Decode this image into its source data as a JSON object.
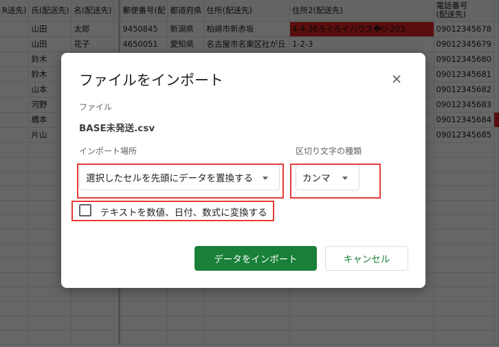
{
  "sheet": {
    "headers": [
      "R送先)",
      "氏(配送先)",
      "名(配送先)",
      "",
      "郵便番号(配",
      "都道府県",
      "住所(配送先)",
      "住所2(配送先)",
      "電話番号\n(配送先)"
    ],
    "rows": [
      [
        "",
        "山田",
        "太郎",
        "",
        "9450845",
        "新潟県",
        "柏崎市新赤坂",
        "4-4-36ろぐろぐハウス�U-203",
        "09012345678"
      ],
      [
        "",
        "山田",
        "花子",
        "",
        "4650051",
        "愛知県",
        "名古屋市名東区社が丘",
        "1-2-3",
        "09012345679"
      ],
      [
        "",
        "鈴木",
        "",
        "",
        "",
        "",
        "",
        "",
        "09012345680"
      ],
      [
        "",
        "鈴木",
        "",
        "",
        "",
        "",
        "",
        "",
        "09012345681"
      ],
      [
        "",
        "山本",
        "",
        "",
        "",
        "",
        "",
        "",
        "09012345682"
      ],
      [
        "",
        "河野",
        "",
        "",
        "",
        "",
        "",
        "",
        "09012345683"
      ],
      [
        "",
        "橋本",
        "",
        "",
        "",
        "",
        "",
        "",
        "09012345684"
      ],
      [
        "",
        "片山",
        "",
        "",
        "",
        "",
        "",
        "",
        "09012345685"
      ],
      [
        "",
        "",
        "",
        "",
        "",
        "",
        "",
        "",
        ""
      ],
      [
        "",
        "",
        "",
        "",
        "",
        "",
        "",
        "",
        ""
      ],
      [
        "",
        "",
        "",
        "",
        "",
        "",
        "",
        "",
        ""
      ],
      [
        "",
        "",
        "",
        "",
        "",
        "",
        "",
        "",
        ""
      ],
      [
        "",
        "",
        "",
        "",
        "",
        "",
        "",
        "",
        ""
      ],
      [
        "",
        "",
        "",
        "",
        "",
        "",
        "",
        "",
        ""
      ],
      [
        "",
        "",
        "",
        "",
        "",
        "",
        "",
        "",
        ""
      ],
      [
        "",
        "",
        "",
        "",
        "",
        "",
        "",
        "",
        ""
      ],
      [
        "",
        "",
        "",
        "",
        "",
        "",
        "",
        "",
        ""
      ],
      [
        "",
        "",
        "",
        "",
        "",
        "",
        "",
        "",
        ""
      ],
      [
        "",
        "",
        "",
        "",
        "",
        "",
        "",
        "",
        ""
      ],
      [
        "",
        "",
        "",
        "",
        "",
        "",
        "",
        "",
        ""
      ],
      [
        "",
        "",
        "",
        "",
        "",
        "",
        "",
        "",
        ""
      ],
      [
        "",
        "",
        "",
        "",
        "",
        "",
        "",
        "",
        ""
      ]
    ]
  },
  "dialog": {
    "title": "ファイルをインポート",
    "file_label": "ファイル",
    "file_name": "BASE未発送.csv",
    "location_label": "インポート場所",
    "location_value": "選択したセルを先頭にデータを置換する",
    "separator_label": "区切り文字の種類",
    "separator_value": "カンマ",
    "convert_label": "テキストを数値、日付、数式に変換する",
    "convert_checked": false,
    "import_button": "データをインポート",
    "cancel_button": "キャンセル"
  },
  "colors": {
    "accent_green": "#188038",
    "highlight_red": "#e53935",
    "cell_red": "#e32424"
  },
  "icons": {
    "close": "close-icon",
    "dropdown": "caret-down-icon"
  }
}
